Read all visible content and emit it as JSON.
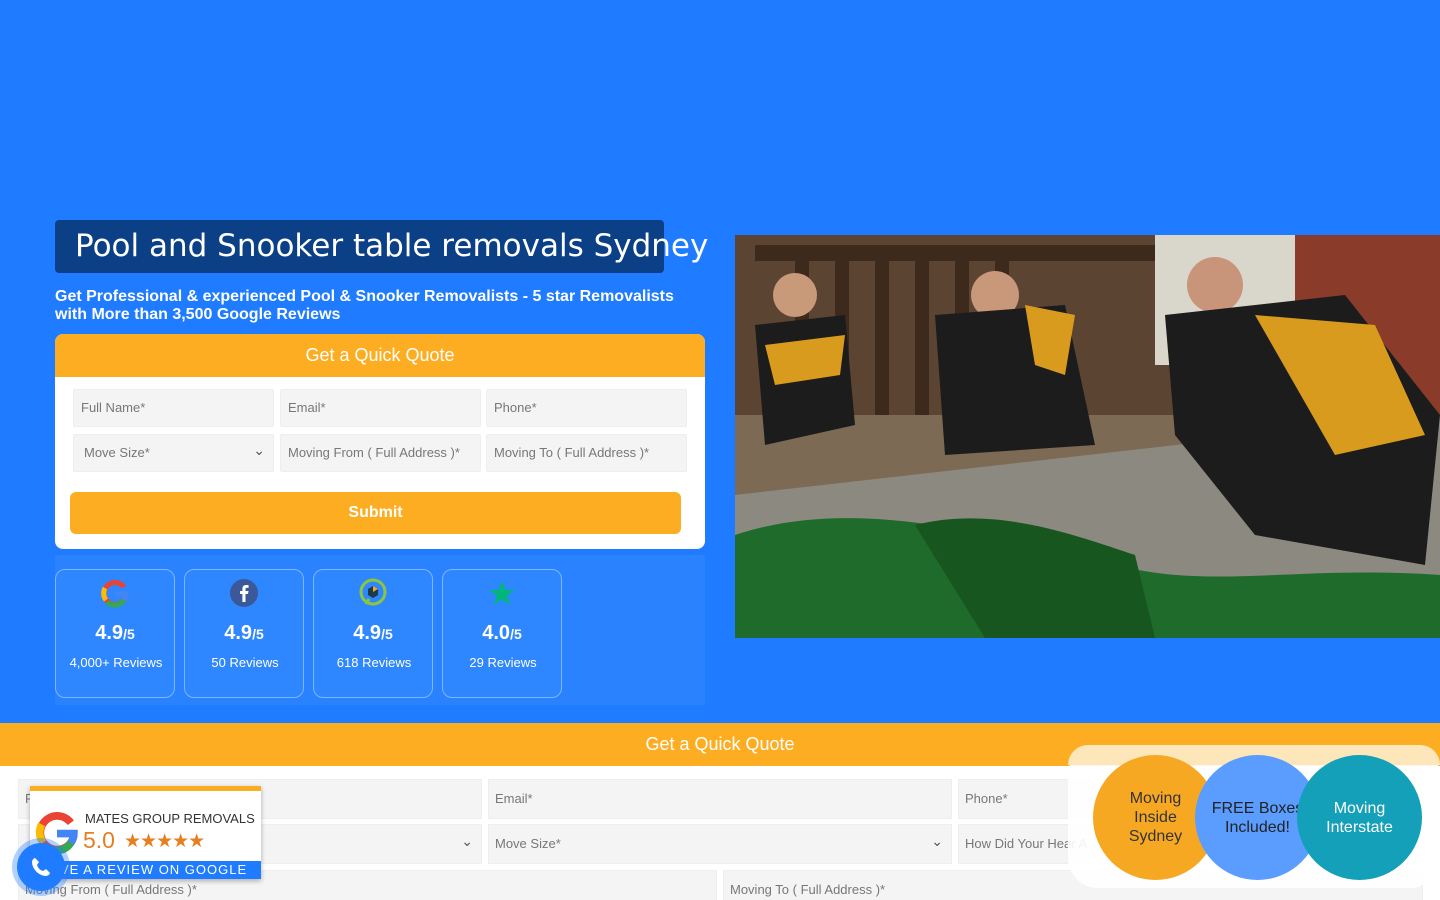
{
  "hero": {
    "title": "Pool and Snooker table removals Sydney",
    "subtitle": "Get Professional & experienced Pool & Snooker Removalists - 5 star Removalists with More than 3,500 Google Reviews"
  },
  "quote_form": {
    "header": "Get a Quick Quote",
    "full_name": "Full Name*",
    "email": "Email*",
    "phone": "Phone*",
    "move_size": "Move Size*",
    "moving_from": "Moving From ( Full Address )*",
    "moving_to": "Moving To ( Full Address )*",
    "submit": "Submit"
  },
  "reviews": [
    {
      "icon": "google-icon",
      "score": "4.9",
      "out_of": "/5",
      "count": "4,000+ Reviews"
    },
    {
      "icon": "facebook-icon",
      "score": "4.9",
      "out_of": "/5",
      "count": "50 Reviews"
    },
    {
      "icon": "productreview-icon",
      "score": "4.9",
      "out_of": "/5",
      "count": "618 Reviews"
    },
    {
      "icon": "trustpilot-icon",
      "score": "4.0",
      "out_of": "/5",
      "count": "29 Reviews"
    }
  ],
  "bottom_form": {
    "header": "Get a Quick Quote",
    "first_field_partial": "F",
    "email": "Email*",
    "phone": "Phone*",
    "move_size": "Move Size*",
    "how_did_you_hear": "How Did Your Hear A",
    "moving_from": "Moving From ( Full Address )*",
    "moving_to": "Moving To ( Full Address )*"
  },
  "badges": [
    {
      "label": "Moving Inside Sydney",
      "color": "#f7a823"
    },
    {
      "label": "FREE Boxes Included!",
      "color": "#5b9cff"
    },
    {
      "label": "Moving Interstate",
      "color": "#14a0b8"
    }
  ],
  "google_badge": {
    "company": "MATES GROUP REMOVALS",
    "score": "5.0",
    "stars": "★★★★★",
    "cta": "VE A REVIEW ON GOOGLE"
  },
  "colors": {
    "background": "#1f7bff",
    "accent": "#fdad21",
    "title_bg": "#0b3f86"
  }
}
